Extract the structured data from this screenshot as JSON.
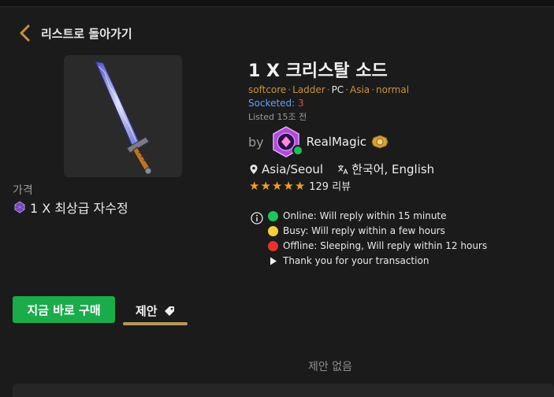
{
  "nav": {
    "back_label": "리스트로 돌아가기"
  },
  "item": {
    "title": "1 X 크리스탈 소드",
    "meta": {
      "mode": "softcore",
      "ladder": "Ladder",
      "platform": "PC",
      "region": "Asia",
      "difficulty": "normal"
    },
    "socketed_label": "Socketed:",
    "socketed_value": "3",
    "listed": "Listed 15조 전"
  },
  "price": {
    "label": "가격",
    "value": "1 X 최상급 자수정"
  },
  "seller": {
    "by": "by",
    "name": "RealMagic",
    "location": "Asia/Seoul",
    "languages": "한국어, English",
    "rating_stars": 5,
    "reviews": "129 리뷰"
  },
  "status_legend": [
    {
      "color": "#1ec45c",
      "text": "Online: Will reply within 15 minute"
    },
    {
      "color": "#f4cf3a",
      "text": "Busy: Will reply within a few hours"
    },
    {
      "color": "#e8322a",
      "text": "Offline: Sleeping, Will reply within 12 hours"
    }
  ],
  "thanks": "Thank you for your transaction",
  "actions": {
    "buy_now": "지금 바로 구매",
    "offer_tab": "제안"
  },
  "offers": {
    "empty": "제안 없음"
  },
  "colors": {
    "accent_gold": "#b5975e",
    "buy_green": "#1aab4b",
    "meta_orange": "#c8913c",
    "socketed_blue": "#5da0ff",
    "star": "#f39c2b"
  }
}
